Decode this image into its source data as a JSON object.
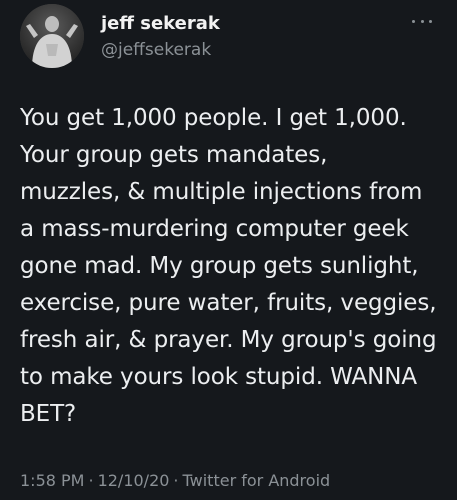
{
  "tweet": {
    "author": {
      "display_name": "jeff sekerak",
      "handle": "@jeffsekerak",
      "avatar_icon": "avatar-photo"
    },
    "more_icon": "more-options-icon",
    "text": "You get 1,000 people. I get 1,000.\nYour group gets mandates,\nmuzzles, & multiple injections from\na mass-murdering computer geek\ngone mad. My group gets sunlight,\nexercise, pure water, fruits, veggies,\nfresh air, & prayer. My group's going\nto make yours look stupid. WANNA\nBET?",
    "time": "1:58 PM",
    "separator": "·",
    "date": "12/10/20",
    "source": "Twitter for Android"
  },
  "colors": {
    "background": "#15181c",
    "text_primary": "#eceef0",
    "text_secondary": "#8b9196"
  }
}
